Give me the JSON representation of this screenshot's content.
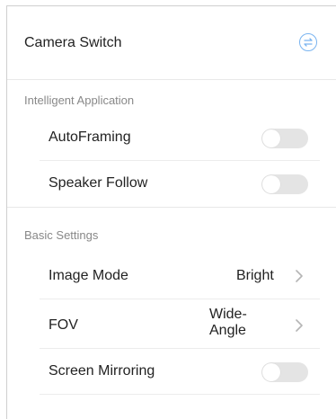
{
  "header": {
    "title": "Camera Switch",
    "action_icon": "swap-icon"
  },
  "sections": {
    "intelligent": {
      "label": "Intelligent Application",
      "items": [
        {
          "label": "AutoFraming",
          "control": "toggle",
          "on": false
        },
        {
          "label": "Speaker Follow",
          "control": "toggle",
          "on": false
        }
      ]
    },
    "basic": {
      "label": "Basic Settings",
      "items": [
        {
          "label": "Image Mode",
          "value": "Bright",
          "control": "chevron"
        },
        {
          "label": "FOV",
          "value": "Wide-Angle",
          "control": "chevron"
        },
        {
          "label": "Screen Mirroring",
          "control": "toggle",
          "on": false
        }
      ]
    }
  },
  "colors": {
    "accent": "#7ab4f0",
    "toggle_off": "#e4e4e4",
    "section_label": "#888888"
  }
}
